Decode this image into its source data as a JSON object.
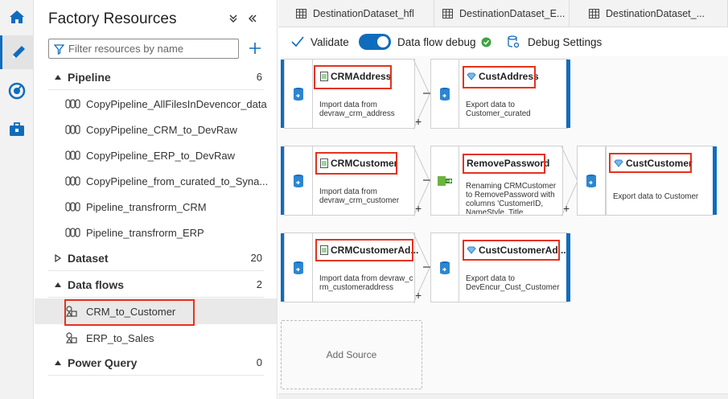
{
  "rail": {
    "items": [
      "home-icon",
      "author-icon",
      "monitor-icon",
      "manage-icon"
    ]
  },
  "panel": {
    "title": "Factory Resources",
    "filter_placeholder": "Filter resources by name",
    "sections": [
      {
        "label": "Pipeline",
        "count": "6",
        "expanded": true,
        "items": [
          "CopyPipeline_AllFilesInDevencor_data",
          "CopyPipeline_CRM_to_DevRaw",
          "CopyPipeline_ERP_to_DevRaw",
          "CopyPipeline_from_curated_to_Syna...",
          "Pipeline_transfrorm_CRM",
          "Pipeline_transfrorm_ERP"
        ]
      },
      {
        "label": "Dataset",
        "count": "20",
        "expanded": false,
        "items": []
      },
      {
        "label": "Data flows",
        "count": "2",
        "expanded": true,
        "items": [
          "CRM_to_Customer",
          "ERP_to_Sales"
        ]
      },
      {
        "label": "Power Query",
        "count": "0",
        "expanded": false,
        "items": []
      }
    ]
  },
  "tabs": [
    "DestinationDataset_hfl",
    "DestinationDataset_E...",
    "DestinationDataset_..."
  ],
  "toolbar": {
    "validate": "Validate",
    "debug": "Data flow debug",
    "debug_settings": "Debug Settings"
  },
  "flows": [
    {
      "source": {
        "name": "CRMAddress",
        "desc": "Import data from devraw_crm_address"
      },
      "steps": [],
      "sink": {
        "name": "CustAddress",
        "desc": "Export data to Customer_curated"
      }
    },
    {
      "source": {
        "name": "CRMCustomer",
        "desc": "Import data from devraw_crm_customer"
      },
      "steps": [
        {
          "name": "RemovePassword",
          "desc": "Renaming CRMCustomer to RemovePassword with columns 'CustomerID, NameStyle, Title"
        }
      ],
      "sink": {
        "name": "CustCustomer",
        "desc": "Export data to Customer"
      }
    },
    {
      "source": {
        "name": "CRMCustomerAd...",
        "desc": "Import data from devraw_crm_customeraddress"
      },
      "steps": [],
      "sink": {
        "name": "CustCustomerAd...",
        "desc": "Export data to DevEncur_Cust_Customer"
      }
    }
  ],
  "add_source": "Add Source",
  "colors": {
    "accent": "#0f6cbd",
    "highlight": "#e5321d",
    "success": "#3fa33f"
  }
}
